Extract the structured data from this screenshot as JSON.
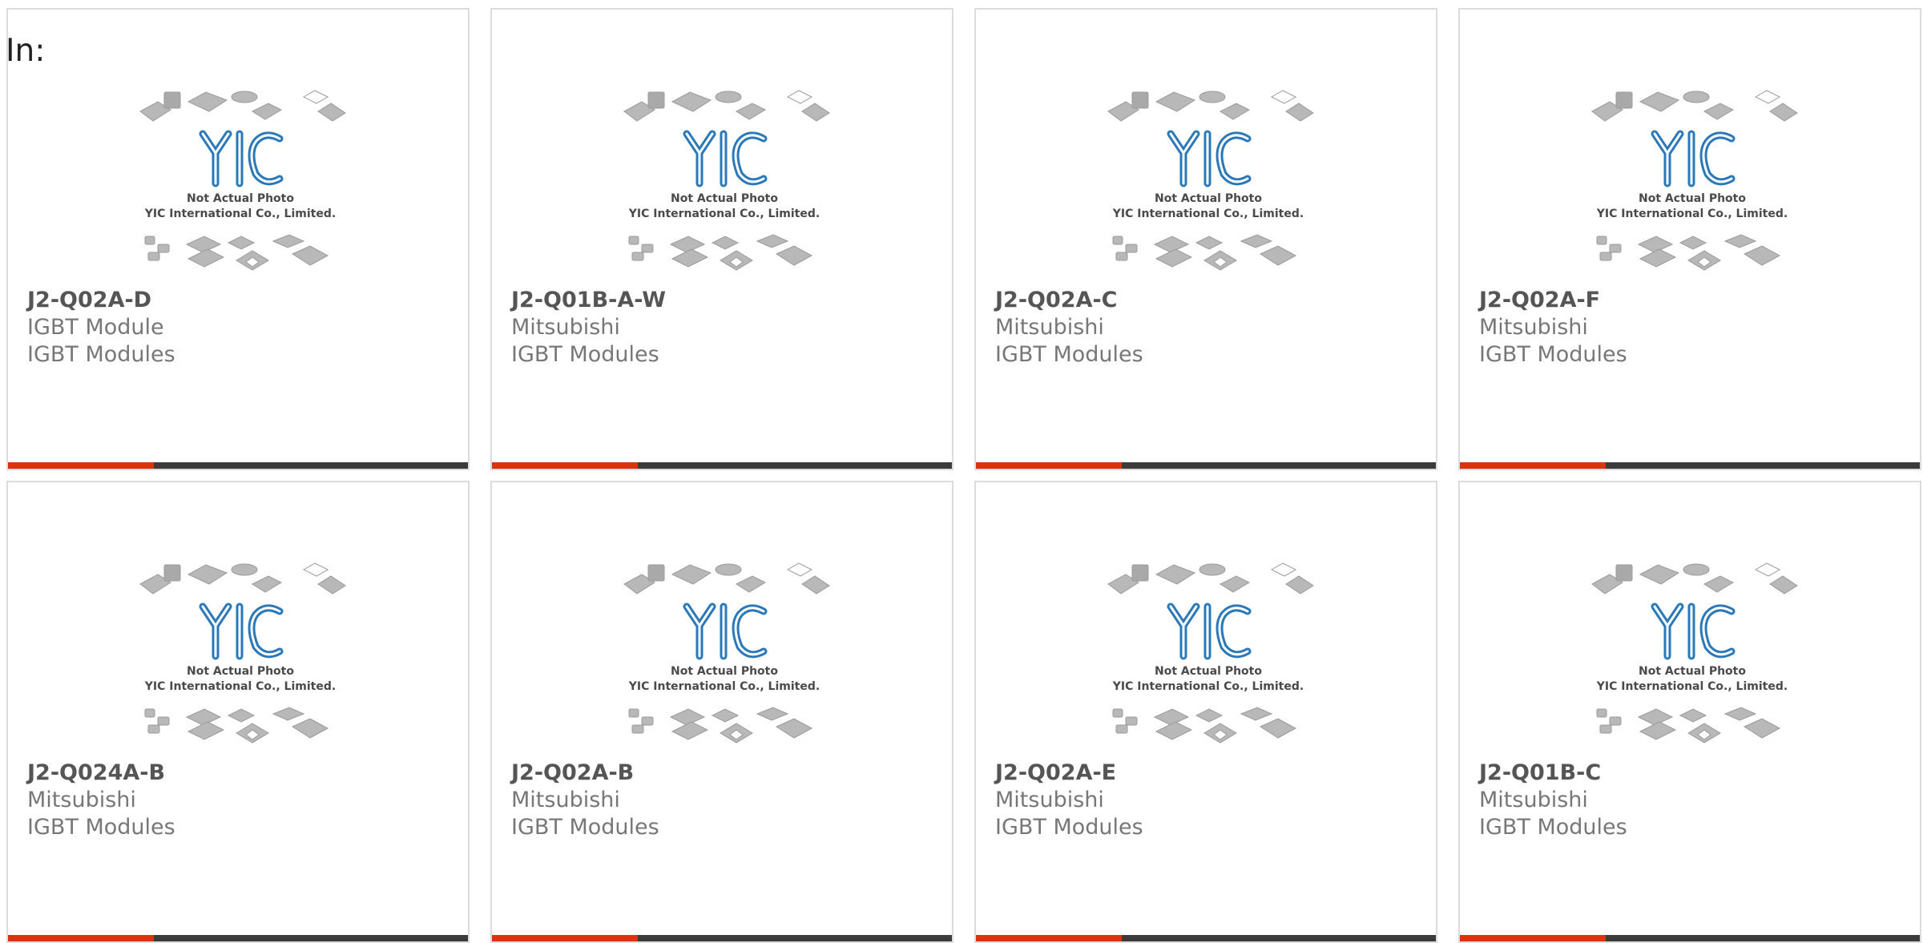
{
  "prefix_label": "In:",
  "brand": {
    "logo_text": "YIC",
    "note_line1": "Not Actual Photo",
    "note_line2": "YIC International Co., Limited.",
    "logo_color": "#2a78b8",
    "accent_color": "#e0300f"
  },
  "products": [
    {
      "part_number": "J2-Q02A-D",
      "line2": "IGBT Module",
      "category": "IGBT Modules"
    },
    {
      "part_number": "J2-Q01B-A-W",
      "line2": "Mitsubishi",
      "category": "IGBT Modules"
    },
    {
      "part_number": "J2-Q02A-C",
      "line2": "Mitsubishi",
      "category": "IGBT Modules"
    },
    {
      "part_number": "J2-Q02A-F",
      "line2": "Mitsubishi",
      "category": "IGBT Modules"
    },
    {
      "part_number": "J2-Q024A-B",
      "line2": "Mitsubishi",
      "category": "IGBT Modules"
    },
    {
      "part_number": "J2-Q02A-B",
      "line2": "Mitsubishi",
      "category": "IGBT Modules"
    },
    {
      "part_number": "J2-Q02A-E",
      "line2": "Mitsubishi",
      "category": "IGBT Modules"
    },
    {
      "part_number": "J2-Q01B-C",
      "line2": "Mitsubishi",
      "category": "IGBT Modules"
    }
  ]
}
